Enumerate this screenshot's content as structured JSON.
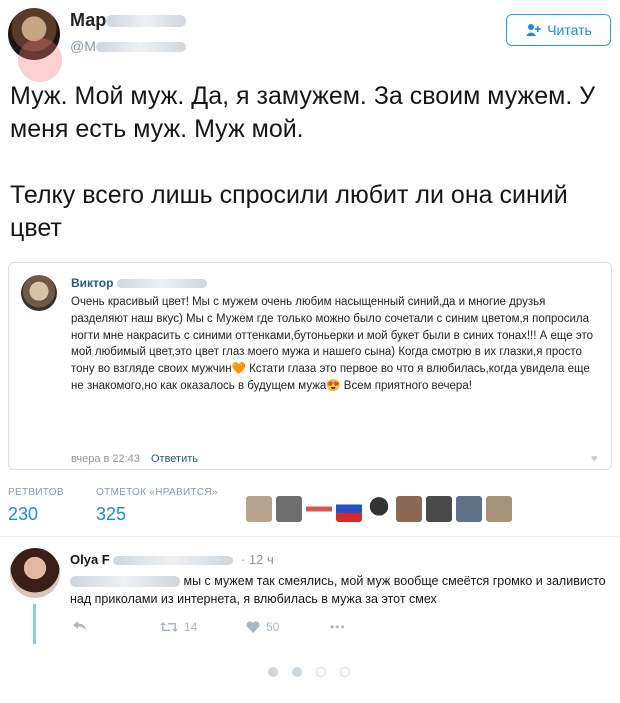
{
  "tweet": {
    "author_name": "Мар",
    "author_handle": "@M",
    "follow_label": "Читать",
    "text_p1": "Муж. Мой муж. Да, я замужем. За своим мужем. У меня есть муж. Муж мой.",
    "text_p2": "Телку всего лишь спросили любит ли она синий цвет"
  },
  "quote": {
    "name": "Виктор",
    "text": "Очень красивый цвет! Мы с мужем очень любим насыщенный синий,да и многие друзья разделяют наш вкус) Мы с Мужем где только можно было сочетали с синим цветом,я попросила ногти мне накрасить с синими оттенками,бутоньерки и мой букет были в синих тонах!!! А еще это мой любимый цвет,это цвет глаз моего мужа и нашего сына) Когда смотрю в их глазки,я просто тону во взгляде своих мужчин🧡 Кстати глаза это первое во что я влюбилась,когда увидела еще не знакомого,но как оказалось в будущем мужа😍 Всем приятного вечера!",
    "time": "вчера в 22:43",
    "reply_label": "Ответить"
  },
  "stats": {
    "retweets_label": "РЕТВИТОВ",
    "retweets": "230",
    "likes_label": "ОТМЕТОК «НРАВИТСЯ»",
    "likes": "325"
  },
  "reply": {
    "name": "Olya F",
    "time": "· 12 ч",
    "text": "мы с мужем так смеялись, мой муж вообще смеётся громко и заливисто над приколами из интернета, я влюбилась в мужа за этот смех",
    "retweets": "14",
    "likes": "50",
    "more": "•••"
  },
  "colors": {
    "accent": "#1da1f2",
    "vk_link": "#2a5885"
  },
  "icons": [
    "follow-icon",
    "reply-icon",
    "retweet-icon",
    "heart-icon",
    "more-icon"
  ]
}
